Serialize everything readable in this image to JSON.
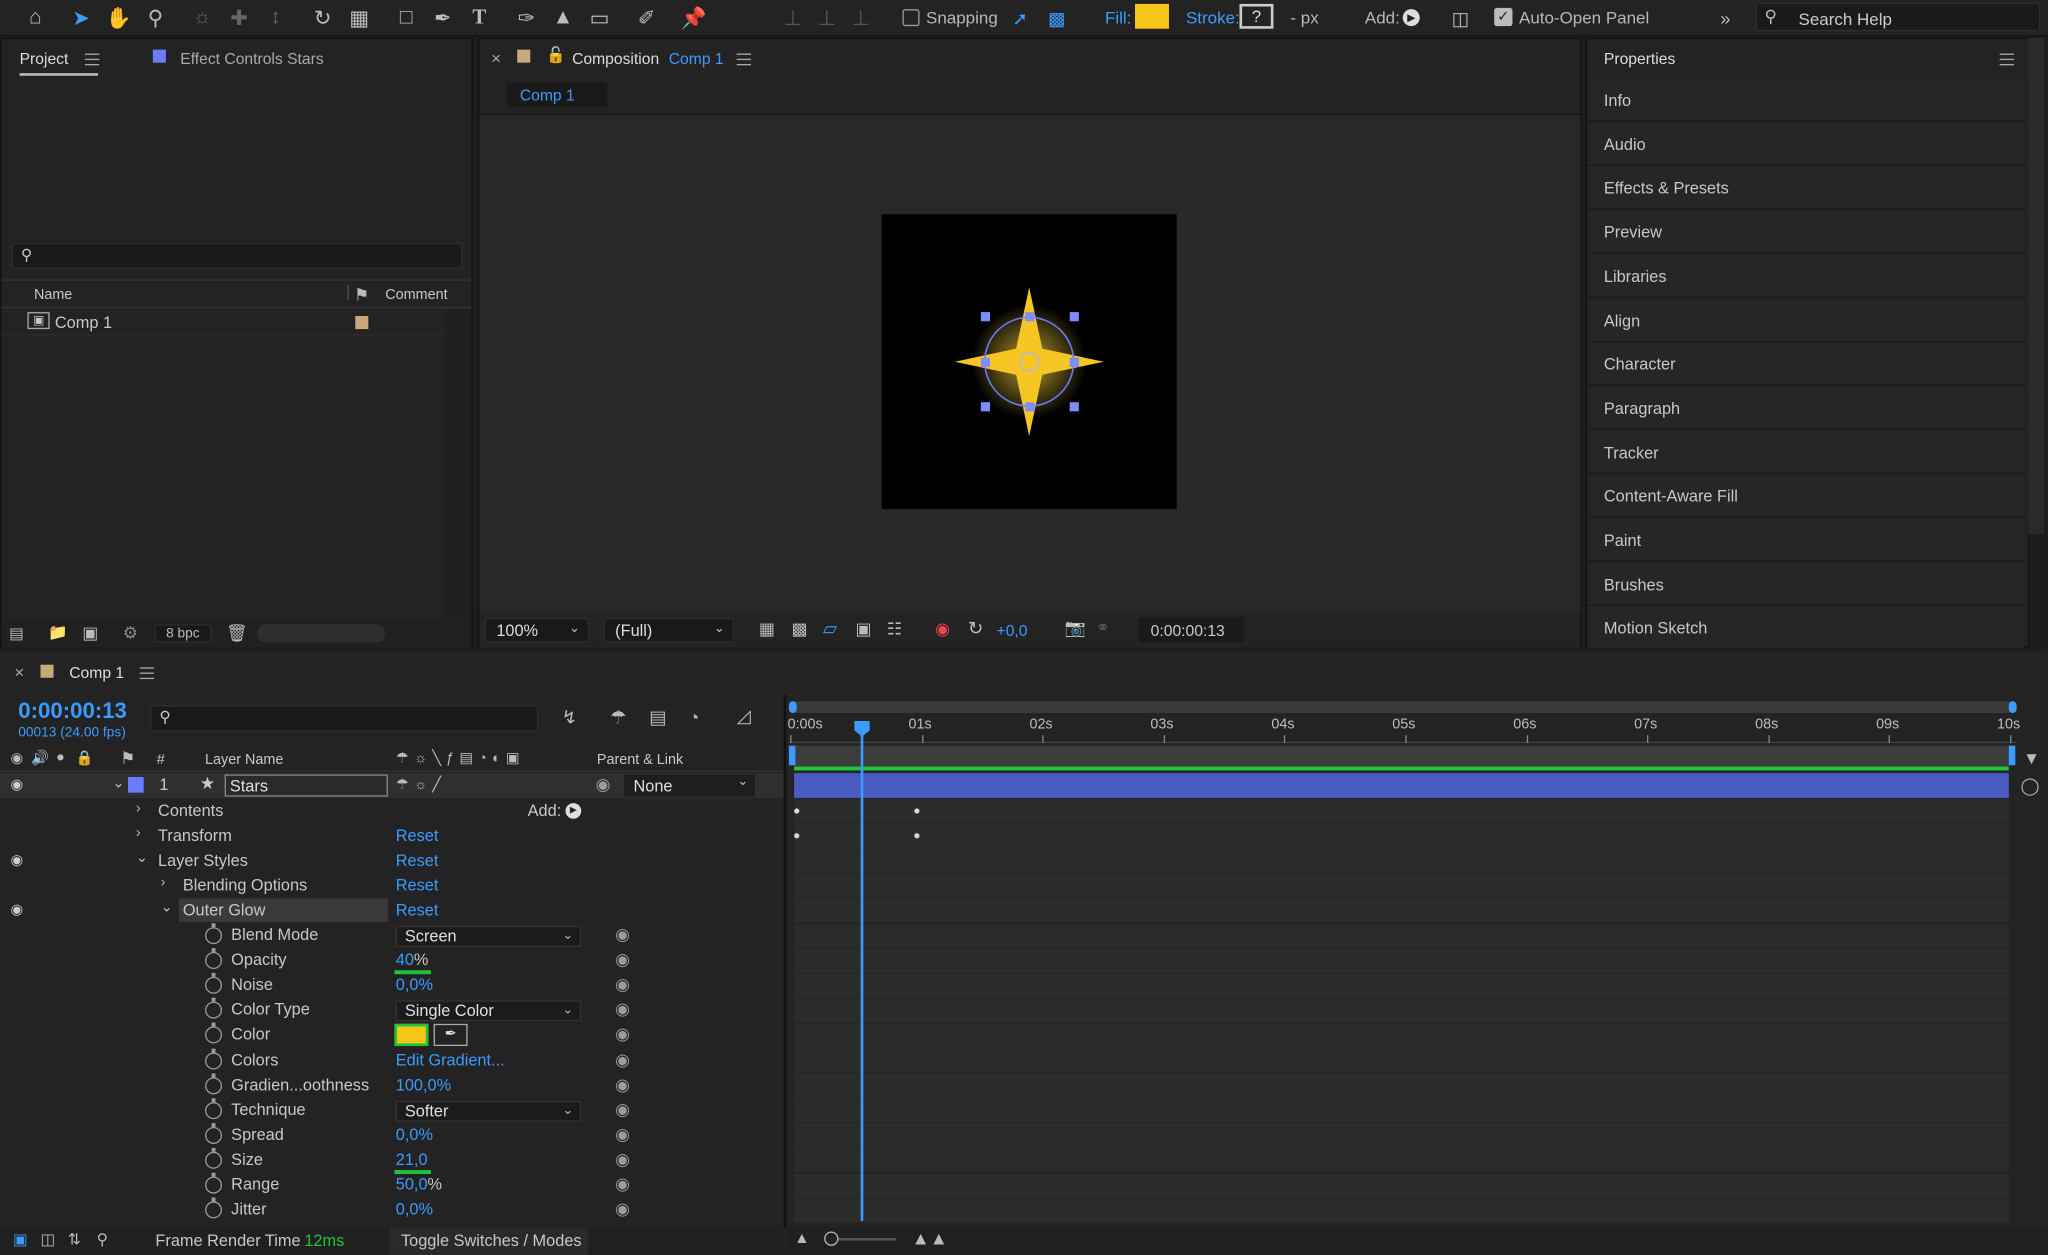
{
  "toolbar": {
    "snapping": "Snapping",
    "fill": "Fill:",
    "fill_color": "#f5c518",
    "stroke": "Stroke:",
    "stroke_value": "?",
    "px": "- px",
    "add": "Add:",
    "auto_open": "Auto-Open Panel",
    "search_help": "Search Help"
  },
  "project": {
    "tab": "Project",
    "effect_tab": "Effect Controls Stars",
    "col_name": "Name",
    "col_comment": "Comment",
    "item": "Comp 1",
    "bpc": "8 bpc"
  },
  "comp": {
    "tab_prefix": "Composition",
    "tab_name": "Comp 1",
    "subtab": "Comp 1",
    "zoom": "100%",
    "resolution": "(Full)",
    "exposure": "+0,0",
    "timecode": "0:00:00:13"
  },
  "properties": {
    "title": "Properties",
    "items": [
      "Info",
      "Audio",
      "Effects & Presets",
      "Preview",
      "Libraries",
      "Align",
      "Character",
      "Paragraph",
      "Tracker",
      "Content-Aware Fill",
      "Paint",
      "Brushes",
      "Motion Sketch"
    ]
  },
  "timeline": {
    "tab": "Comp 1",
    "timecode": "0:00:00:13",
    "fps": "00013 (24.00 fps)",
    "col_num": "#",
    "col_layer": "Layer Name",
    "col_parent": "Parent & Link",
    "layer": {
      "num": "1",
      "name": "Stars",
      "parent": "None"
    },
    "contents": "Contents",
    "add": "Add:",
    "transform": "Transform",
    "reset": "Reset",
    "layer_styles": "Layer Styles",
    "blending": "Blending Options",
    "outer_glow": "Outer Glow",
    "props": [
      {
        "label": "Blend Mode",
        "value": "Screen",
        "type": "dd"
      },
      {
        "label": "Opacity",
        "value": "40",
        "unit": "%",
        "type": "num"
      },
      {
        "label": "Noise",
        "value": "0,0%",
        "type": "val"
      },
      {
        "label": "Color Type",
        "value": "Single Color",
        "type": "dd"
      },
      {
        "label": "Color",
        "value": "",
        "type": "color"
      },
      {
        "label": "Colors",
        "value": "Edit Gradient...",
        "type": "val"
      },
      {
        "label": "Gradien...oothness",
        "value": "100,0%",
        "type": "val"
      },
      {
        "label": "Technique",
        "value": "Softer",
        "type": "dd"
      },
      {
        "label": "Spread",
        "value": "0,0%",
        "type": "val"
      },
      {
        "label": "Size",
        "value": "21,0",
        "type": "val"
      },
      {
        "label": "Range",
        "value": "50,0",
        "unit": "%",
        "type": "num"
      },
      {
        "label": "Jitter",
        "value": "0,0%",
        "type": "val"
      }
    ],
    "ruler": [
      "0:00s",
      "01s",
      "02s",
      "03s",
      "04s",
      "05s",
      "06s",
      "07s",
      "08s",
      "09s",
      "10s"
    ],
    "frame_render": "Frame Render Time",
    "frame_ms": "12ms",
    "toggle": "Toggle Switches / Modes"
  }
}
